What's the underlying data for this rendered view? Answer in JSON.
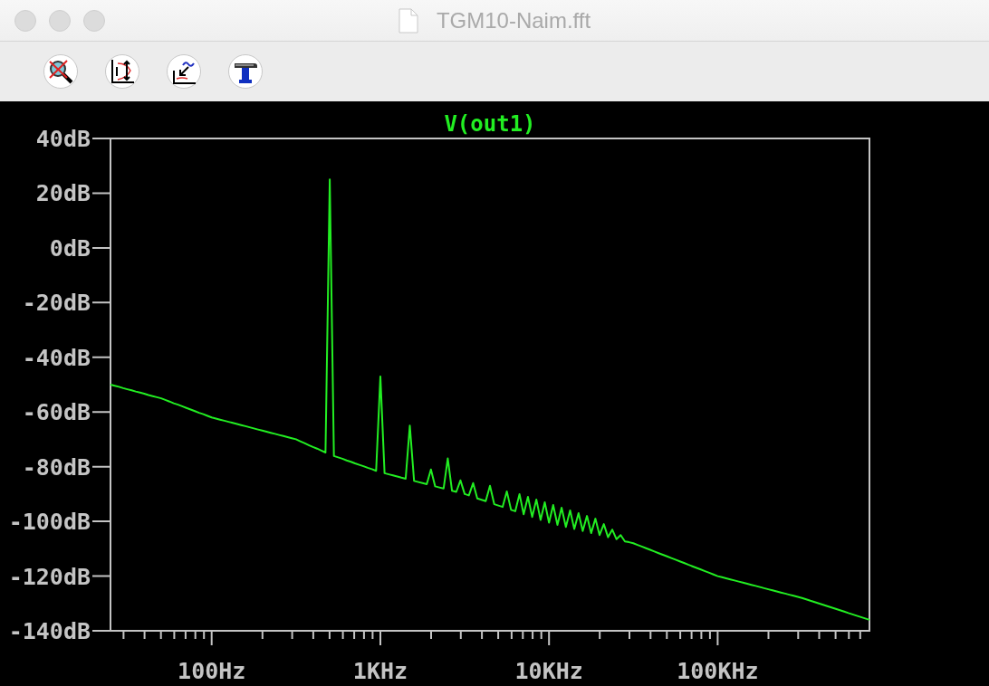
{
  "window": {
    "title": "TGM10-Naim.fft"
  },
  "toolbar": {
    "buttons": [
      {
        "kind": "zoom-cancel"
      },
      {
        "kind": "autorange-y"
      },
      {
        "kind": "zoom-back"
      },
      {
        "kind": "hammer"
      }
    ]
  },
  "plot": {
    "chart_data": {
      "type": "line",
      "categories": [
        null,
        null,
        null,
        null,
        null,
        null,
        null,
        null,
        null,
        null,
        null,
        null,
        null,
        null,
        null,
        null,
        null,
        null,
        null,
        null,
        null,
        null,
        null,
        null,
        "100Hz",
        null,
        null,
        null,
        null,
        null,
        null,
        null,
        null,
        null,
        null,
        null,
        null,
        null,
        null,
        null,
        null,
        null,
        null,
        null,
        null,
        null,
        null,
        null,
        null,
        null,
        null,
        null,
        null,
        null,
        null,
        null,
        null,
        null,
        null,
        null,
        null,
        null,
        null,
        null,
        "1KHz",
        null,
        null,
        null,
        null,
        null,
        null,
        null,
        null,
        null,
        null,
        null,
        null,
        null,
        null,
        null,
        null,
        null,
        null,
        null,
        null,
        null,
        null,
        null,
        null,
        null,
        null,
        null,
        null,
        null,
        null,
        null,
        null,
        null,
        null,
        null,
        null,
        null,
        null,
        null,
        "10KHz",
        null,
        null,
        null,
        null,
        null,
        null,
        null,
        null,
        null,
        null,
        null,
        null,
        null,
        null,
        null,
        null,
        null,
        null,
        null,
        null,
        null,
        null,
        null,
        null,
        null,
        null,
        null,
        null,
        null,
        null,
        null,
        null,
        null,
        null,
        null,
        null,
        null,
        null,
        null,
        "100KHz",
        null,
        null,
        null,
        null,
        null,
        null,
        null,
        null,
        null,
        null,
        null,
        null,
        null,
        null,
        null,
        null,
        null,
        null,
        null,
        null,
        null,
        null,
        null,
        null,
        null,
        null,
        null,
        null,
        null,
        null,
        null,
        null,
        null,
        null,
        null,
        null
      ],
      "series": [
        {
          "name": "V(out1)",
          "color": "#22ee22",
          "values": [
            -50,
            -50.4,
            -50.8,
            -51.3,
            -51.7,
            -52.1,
            -52.5,
            -52.9,
            -53.3,
            -53.8,
            -54.2,
            -54.6,
            -55,
            -55.6,
            -56.2,
            -56.8,
            -57.3,
            -57.9,
            -58.5,
            -59.1,
            -59.7,
            -60.3,
            -60.8,
            -61.4,
            -62,
            -62.4,
            -62.8,
            -63.2,
            -63.6,
            -64,
            -64.4,
            -64.8,
            -65.2,
            -65.6,
            -66,
            -66.4,
            -66.8,
            -67.2,
            -67.6,
            -68,
            -68.4,
            -68.8,
            -69.2,
            -69.6,
            -70,
            -70.7,
            -71.4,
            -72.1,
            -72.8,
            -73.4,
            -74.1,
            -74.8,
            25,
            -76.1,
            -76.6,
            -77.1,
            -77.7,
            -78.2,
            -78.8,
            -79.3,
            -79.8,
            -80.4,
            -80.9,
            -81.5,
            -47,
            -82.4,
            -82.8,
            -83.2,
            -83.6,
            -84,
            -84.4,
            -65,
            -85.2,
            -85.6,
            -86,
            -86.4,
            -81,
            -87.2,
            -87.6,
            -88,
            -77,
            -88.8,
            -89.2,
            -85,
            -90,
            -90.5,
            -86,
            -91.6,
            -92.1,
            -92.6,
            -87,
            -93.7,
            -94.2,
            -94.7,
            -89,
            -95.8,
            -96.3,
            -90,
            -97.4,
            -91,
            -98.4,
            -92,
            -99.5,
            -93,
            -100.5,
            -94,
            -101.3,
            -95,
            -102,
            -96,
            -102.8,
            -97,
            -103.5,
            -98,
            -104.3,
            -99,
            -105,
            -101,
            -105.8,
            -103,
            -106.5,
            -105,
            -107.3,
            -107.6,
            -108,
            -108.6,
            -109.2,
            -109.8,
            -110.4,
            -111,
            -111.6,
            -112.2,
            -112.8,
            -113.4,
            -114,
            -114.6,
            -115.2,
            -115.8,
            -116.4,
            -117,
            -117.6,
            -118.2,
            -118.8,
            -119.4,
            -120,
            -120.4,
            -120.8,
            -121.2,
            -121.6,
            -122,
            -122.4,
            -122.8,
            -123.2,
            -123.6,
            -124,
            -124.4,
            -124.8,
            -125.2,
            -125.6,
            -126,
            -126.4,
            -126.8,
            -127.2,
            -127.6,
            -128,
            -128.5,
            -129,
            -129.5,
            -130,
            -130.5,
            -131,
            -131.5,
            -132,
            -132.5,
            -133,
            -133.5,
            -134,
            -134.5,
            -135,
            -135.5,
            -136
          ]
        }
      ],
      "ylim": [
        -140,
        40
      ],
      "yticks": [
        {
          "value": 40,
          "label": "40dB"
        },
        {
          "value": 20,
          "label": "20dB"
        },
        {
          "value": 0,
          "label": "0dB"
        },
        {
          "value": -20,
          "label": "-20dB"
        },
        {
          "value": -40,
          "label": "-40dB"
        },
        {
          "value": -60,
          "label": "-60dB"
        },
        {
          "value": -80,
          "label": "-80dB"
        },
        {
          "value": -100,
          "label": "-100dB"
        },
        {
          "value": -120,
          "label": "-120dB"
        },
        {
          "value": -140,
          "label": "-140dB"
        }
      ]
    }
  }
}
